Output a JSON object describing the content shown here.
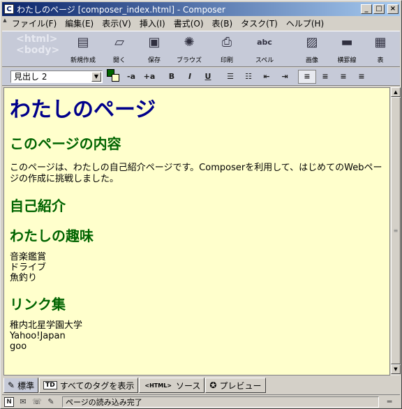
{
  "window": {
    "title": "わたしのページ [composer_index.html] - Composer",
    "app_icon": "composer-icon"
  },
  "menu": {
    "items": [
      "ファイル(F)",
      "編集(E)",
      "表示(V)",
      "挿入(I)",
      "書式(O)",
      "表(B)",
      "タスク(T)",
      "ヘルプ(H)"
    ]
  },
  "toolbar": {
    "logo": {
      "line1": "<html>",
      "line2": "<body>"
    },
    "buttons": [
      {
        "label": "新規作成",
        "icon": "new-icon"
      },
      {
        "label": "開く",
        "icon": "open-icon"
      },
      {
        "label": "保存",
        "icon": "save-icon"
      },
      {
        "label": "ブラウズ",
        "icon": "browse-icon"
      },
      {
        "label": "印刷",
        "icon": "print-icon"
      },
      {
        "label": "スペル",
        "icon": "spell-icon"
      },
      {
        "label": "画像",
        "icon": "image-icon"
      },
      {
        "label": "横罫線",
        "icon": "hr-icon"
      },
      {
        "label": "表",
        "icon": "table-icon"
      }
    ]
  },
  "format": {
    "paragraph_style": "見出し 2",
    "text_color": "#006400",
    "bg_color": "#ffffcc",
    "buttons": [
      "-a",
      "+a",
      "B",
      "I",
      "U"
    ]
  },
  "document": {
    "h1": "わたしのページ",
    "h2_contents": "このページの内容",
    "intro": "このページは、わたしの自己紹介ページです。Composerを利用して、はじめてのWebページの作成に挑戦しました。",
    "h2_profile": "自己紹介",
    "h2_hobby": "わたしの趣味",
    "hobbies": [
      "音楽鑑賞",
      "ドライブ",
      "魚釣り"
    ],
    "h2_links": "リンク集",
    "links": [
      "稚内北星学園大学",
      "Yahoo!Japan",
      "goo"
    ]
  },
  "tabs": [
    {
      "label": "標準",
      "icon": "pencil-icon"
    },
    {
      "label": "すべてのタグを表示",
      "icon": "tag-icon",
      "badge": "TD"
    },
    {
      "label": "ソース",
      "icon": "html-icon",
      "badge": "<HTML>"
    },
    {
      "label": "プレビュー",
      "icon": "preview-icon"
    }
  ],
  "status": {
    "text": "ページの読み込み完了"
  }
}
